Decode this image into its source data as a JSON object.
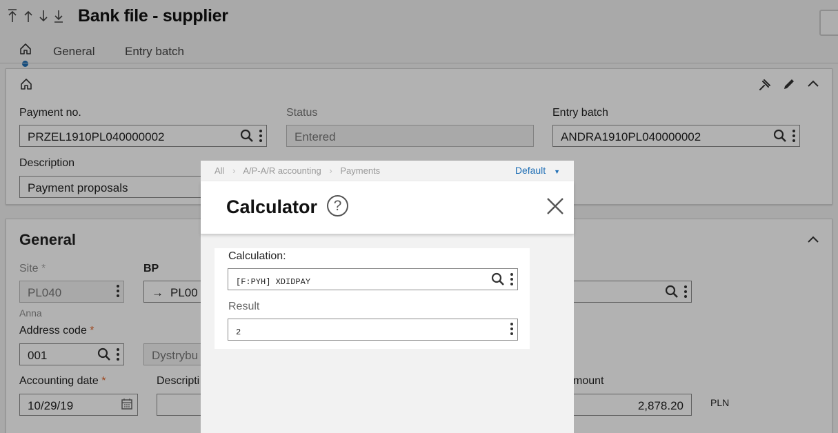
{
  "page": {
    "title": "Bank file - supplier",
    "tabs": [
      "General",
      "Entry batch"
    ]
  },
  "header_card": {
    "payment_no": {
      "label": "Payment no.",
      "value": "PRZEL1910PL040000002"
    },
    "status": {
      "label": "Status",
      "value": "Entered"
    },
    "entry_batch": {
      "label": "Entry batch",
      "value": "ANDRA1910PL040000002"
    },
    "description": {
      "label": "Description",
      "value": "Payment proposals"
    }
  },
  "general": {
    "title": "General",
    "site": {
      "label": "Site",
      "value": "PL040",
      "sub": "Anna"
    },
    "bp": {
      "label": "BP",
      "value": "PL00"
    },
    "address_code": {
      "label": "Address code",
      "value": "001"
    },
    "address_desc": {
      "value": "Dystrybu"
    },
    "accounting_date": {
      "label": "Accounting date",
      "value": "10/29/19"
    },
    "description": {
      "label": "Descripti"
    },
    "amount": {
      "label": "mount",
      "value": "2,878.20",
      "currency": "PLN"
    }
  },
  "dialog": {
    "breadcrumb": [
      "All",
      "A/P-A/R accounting",
      "Payments"
    ],
    "view": "Default",
    "title": "Calculator",
    "help": "?",
    "calculation": {
      "label": "Calculation:",
      "value": "[F:PYH] XDIDPAY"
    },
    "result": {
      "label": "Result",
      "value": "2"
    }
  },
  "colors": {
    "accent": "#1f6fb5",
    "required": "#e0642a"
  }
}
